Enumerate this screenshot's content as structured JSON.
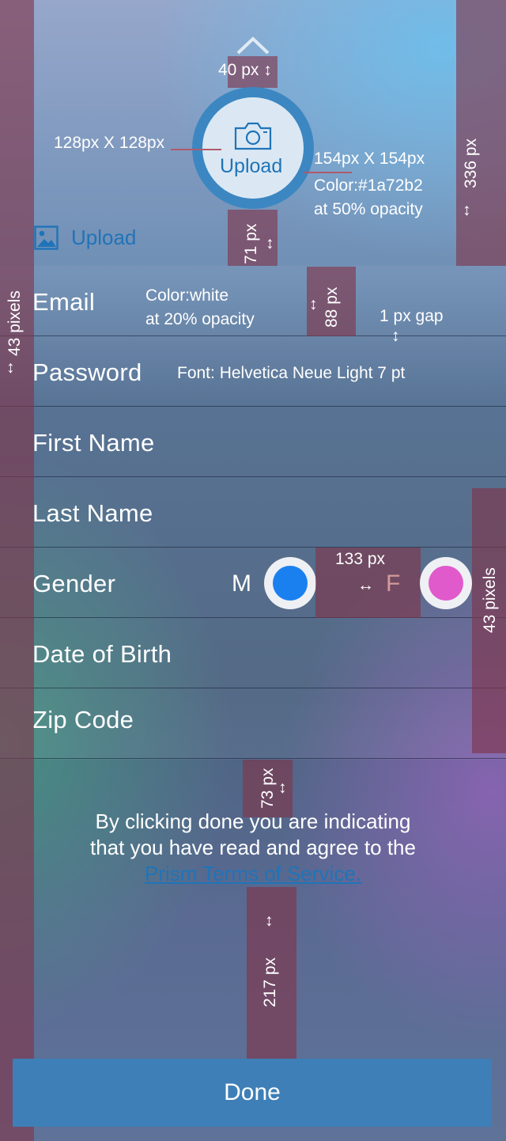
{
  "header": {
    "chevron_icon": "chevron-up-icon",
    "camera_icon": "camera-icon",
    "photo_icon": "image-icon",
    "circle_upload_label": "Upload",
    "upload_link_label": "Upload",
    "colors": {
      "ring": "#3c87c2",
      "inner": "#dbe8f3",
      "link": "#1a72b2"
    }
  },
  "form": {
    "rows": [
      {
        "label": "Email"
      },
      {
        "label": "Password"
      },
      {
        "label": "First Name"
      },
      {
        "label": "Last Name"
      },
      {
        "label": "Gender"
      },
      {
        "label": "Date of Birth"
      },
      {
        "label": "Zip Code"
      }
    ],
    "gender": {
      "male_label": "M",
      "female_label": "F",
      "selected": "M",
      "male_color": "#1a80f0",
      "female_color": "#e05acb"
    }
  },
  "terms": {
    "line1": "By clicking done you are indicating",
    "line2": "that you have read and agree to the",
    "link": "Prism Terms of Service."
  },
  "done_label": "Done",
  "annotations": {
    "top_gap": "40 px",
    "inner_size": "128px X 128px",
    "outer_size": "154px X 154px",
    "color_line1": "Color:#1a72b2",
    "color_line2": "at 50% opacity",
    "header_height": "336 px",
    "circle_gap": "71 px",
    "row_height": "88 px",
    "row_color_line1": "Color:white",
    "row_color_line2": "at 20% opacity",
    "gap_1px": "1 px gap",
    "font_note": "Font: Helvetica Neue Light 7 pt",
    "left_margin": "43 pixels",
    "right_margin": "43 pixels",
    "radio_gap": "133 px",
    "form_gap": "73 px",
    "bottom_gap": "217 px"
  }
}
